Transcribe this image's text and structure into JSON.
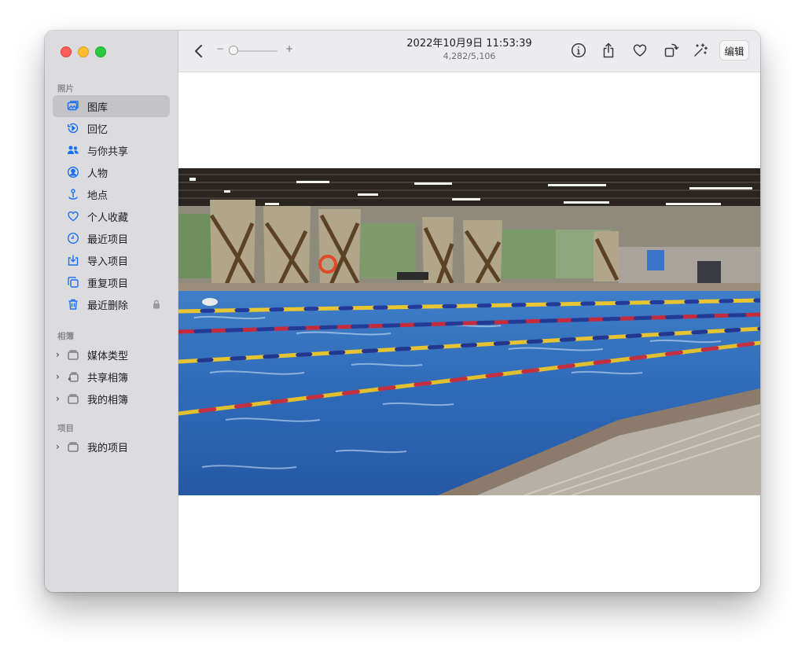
{
  "sidebar": {
    "sections": {
      "photos": "照片",
      "albums": "相簿",
      "projects": "项目"
    },
    "library_items": [
      {
        "label": "图库",
        "icon": "photo-library-icon",
        "selected": true
      },
      {
        "label": "回忆",
        "icon": "memories-icon"
      },
      {
        "label": "与你共享",
        "icon": "shared-with-you-icon"
      },
      {
        "label": "人物",
        "icon": "people-icon"
      },
      {
        "label": "地点",
        "icon": "places-icon"
      },
      {
        "label": "个人收藏",
        "icon": "heart-icon"
      },
      {
        "label": "最近项目",
        "icon": "recents-icon"
      },
      {
        "label": "导入项目",
        "icon": "imports-icon"
      },
      {
        "label": "重复项目",
        "icon": "duplicates-icon"
      },
      {
        "label": "最近删除",
        "icon": "trash-icon"
      }
    ],
    "album_items": [
      {
        "label": "媒体类型",
        "icon": "folder-stack-icon"
      },
      {
        "label": "共享相簿",
        "icon": "shared-album-icon"
      },
      {
        "label": "我的相簿",
        "icon": "folder-stack-icon"
      }
    ],
    "project_items": [
      {
        "label": "我的项目",
        "icon": "folder-stack-icon"
      }
    ]
  },
  "toolbar": {
    "date": "2022年10月9日 11:53:39",
    "count": "4,282/5,106",
    "zoom_minus": "−",
    "zoom_plus": "+",
    "zoom_level": 0.1,
    "edit_label": "编辑",
    "icons": [
      "info-icon",
      "share-icon",
      "heart-icon",
      "rotate-icon",
      "magic-wand-icon"
    ]
  },
  "colors": {
    "accent": "#1a6ff3",
    "sidebar_bg": "#dcdcdf",
    "selected_bg": "#c4c4c8"
  }
}
